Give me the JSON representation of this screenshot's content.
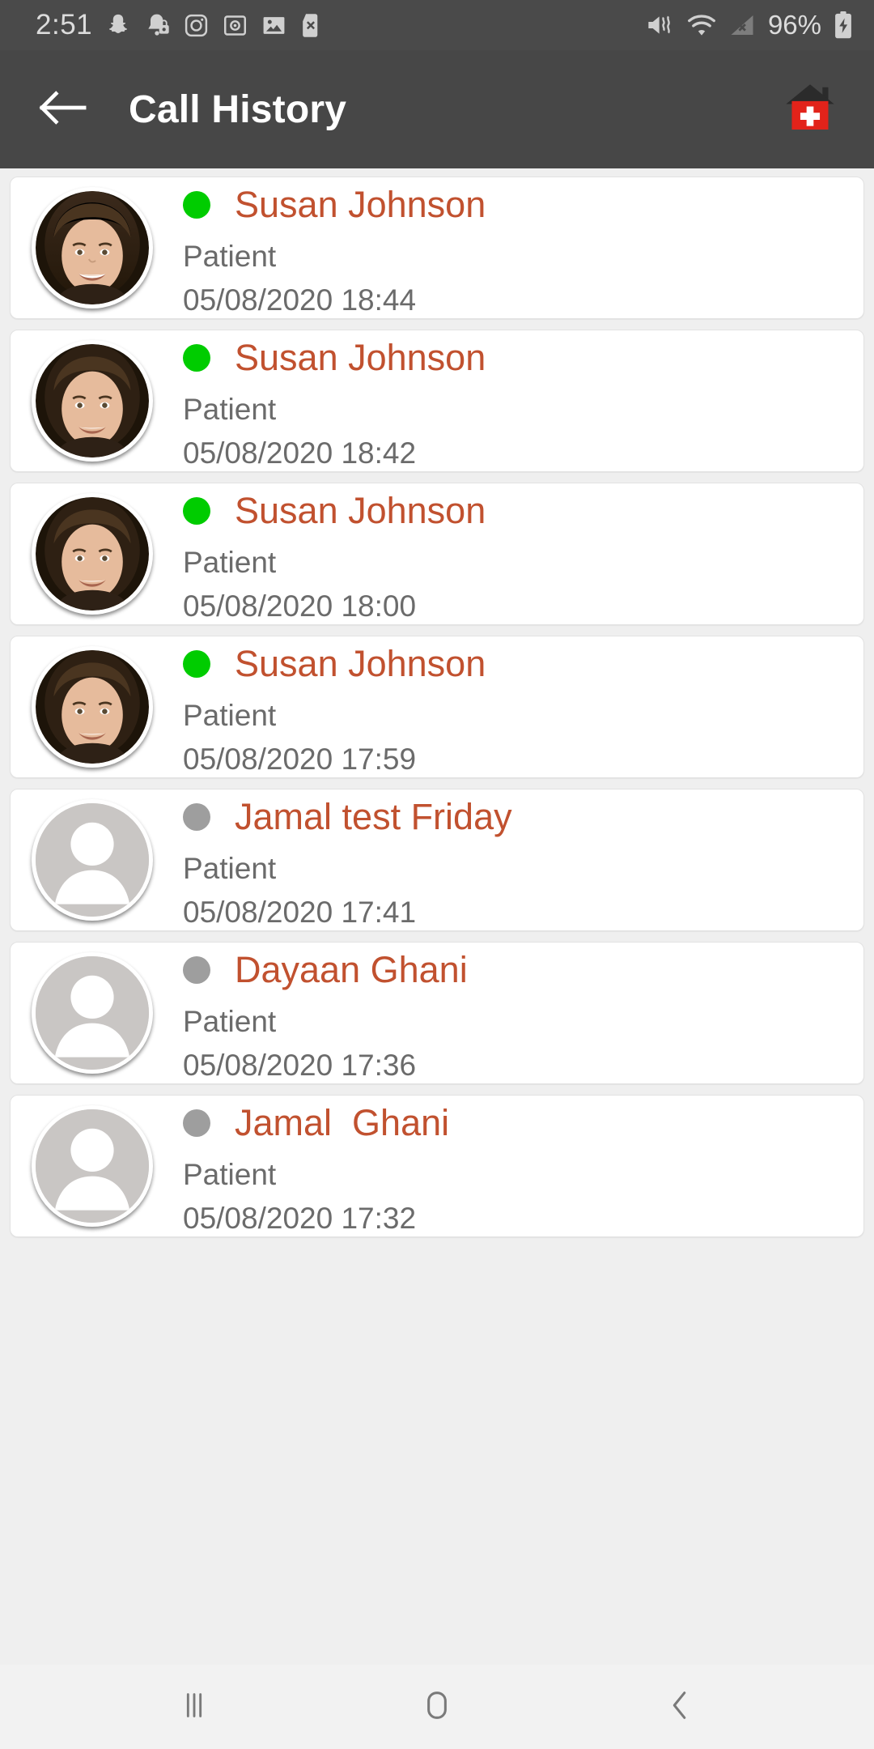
{
  "status_bar": {
    "time": "2:51",
    "battery_percent": "96%",
    "left_icons": [
      "snapchat-icon",
      "notification-silenced-icon",
      "instagram-icon",
      "safe-box-icon",
      "gallery-icon",
      "sd-card-removed-icon"
    ],
    "right_icons": [
      "mute-vibrate-icon",
      "wifi-icon",
      "no-signal-icon",
      "battery-charging-icon"
    ]
  },
  "app_bar": {
    "title": "Call History",
    "back_icon": "arrow-left-icon",
    "home_icon": "clinic-home-icon"
  },
  "colors": {
    "app_bar_bg": "#474747",
    "status_bar_bg": "#4a4a4a",
    "page_bg": "#efefef",
    "card_bg": "#ffffff",
    "name_text": "#c1512f",
    "secondary_text": "#6b6b6b",
    "online_dot": "#00cc00",
    "offline_dot": "#9e9e9e",
    "clinic_red": "#e2231a"
  },
  "call_history": {
    "role_label": "Patient",
    "entries": [
      {
        "name": "Susan Johnson",
        "role": "Patient",
        "timestamp": "05/08/2020 18:44",
        "status": "online",
        "avatar": "photo-woman"
      },
      {
        "name": "Susan Johnson",
        "role": "Patient",
        "timestamp": "05/08/2020 18:42",
        "status": "online",
        "avatar": "photo-woman"
      },
      {
        "name": "Susan Johnson",
        "role": "Patient",
        "timestamp": "05/08/2020 18:00",
        "status": "online",
        "avatar": "photo-woman"
      },
      {
        "name": "Susan Johnson",
        "role": "Patient",
        "timestamp": "05/08/2020 17:59",
        "status": "online",
        "avatar": "photo-woman"
      },
      {
        "name": "Jamal test Friday",
        "role": "Patient",
        "timestamp": "05/08/2020 17:41",
        "status": "offline",
        "avatar": "placeholder-person"
      },
      {
        "name": "Dayaan Ghani",
        "role": "Patient",
        "timestamp": "05/08/2020 17:36",
        "status": "offline",
        "avatar": "placeholder-person"
      },
      {
        "name": "Jamal  Ghani",
        "role": "Patient",
        "timestamp": "05/08/2020 17:32",
        "status": "offline",
        "avatar": "placeholder-person"
      }
    ]
  },
  "nav_bar": {
    "recents_icon": "recents-icon",
    "home_icon": "home-icon",
    "back_icon": "back-chevron-icon"
  }
}
